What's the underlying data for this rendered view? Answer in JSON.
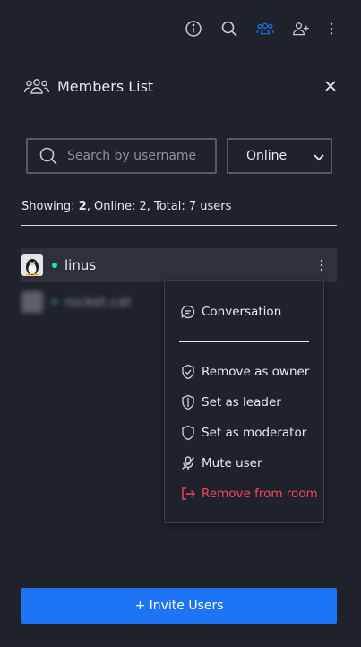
{
  "toolbar": {
    "icons": [
      "info-icon",
      "search-icon",
      "members-icon",
      "add-user-icon",
      "kebab-icon"
    ],
    "active": "members-icon",
    "accent": "#1d74f5"
  },
  "panel": {
    "title": "Members List"
  },
  "filters": {
    "search_placeholder": "Search by username",
    "search_value": "",
    "status_selected": "Online"
  },
  "summary": {
    "showing_label": "Showing: ",
    "showing_count": "2",
    "rest": ", Online: 2, Total: 7 users"
  },
  "members": [
    {
      "username": "linus",
      "status": "online",
      "status_color": "#2de0a5"
    },
    {
      "username": "rocket.cat",
      "status": "online",
      "status_color": "#2de0a5"
    }
  ],
  "context_menu": {
    "conversation": "Conversation",
    "remove_owner": "Remove as owner",
    "set_leader": "Set as leader",
    "set_moderator": "Set as moderator",
    "mute_user": "Mute user",
    "remove_from_room": "Remove from room",
    "danger_color": "#f5455c"
  },
  "invite_button": "+ Invite Users"
}
